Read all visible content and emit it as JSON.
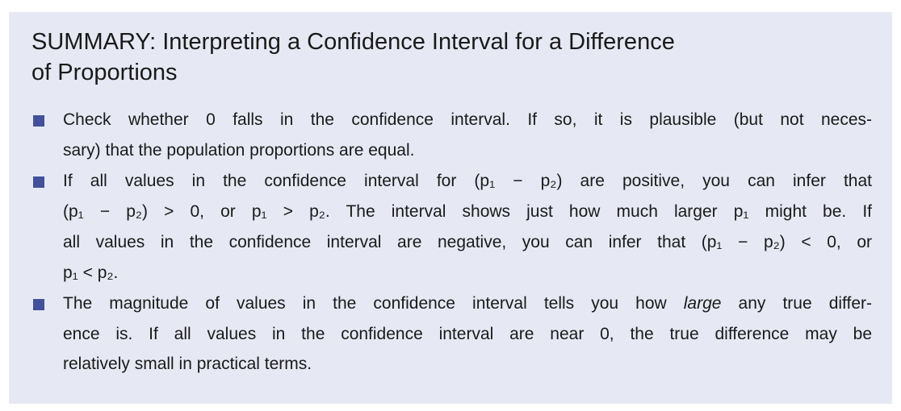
{
  "title": {
    "line1": "SUMMARY: Interpreting a Confidence Interval for a Difference",
    "line2": "of Proportions"
  },
  "bullets": [
    {
      "lines": [
        "Check whether 0 falls in the confidence interval. If so, it is plausible (but not neces-",
        "sary) that the population proportions are equal."
      ]
    },
    {
      "lines": [
        "If all values in the confidence interval for (p₁ − p₂) are positive, you can infer that",
        "(p₁ − p₂) > 0, or p₁ > p₂. The interval shows just how much larger p₁ might be. If",
        "all values in the confidence interval are negative, you can infer that (p₁ − p₂) < 0, or",
        "p₁ < p₂."
      ]
    },
    {
      "line1_pre": "The magnitude of values in the confidence interval tells you how ",
      "line1_em": "large",
      "line1_post": " any true differ-",
      "lines": [
        "ence is. If all values in the confidence interval are near 0, the true difference may be",
        "relatively small in practical terms."
      ]
    }
  ],
  "colors": {
    "background": "#e6e9f4",
    "bullet": "#43519a"
  }
}
